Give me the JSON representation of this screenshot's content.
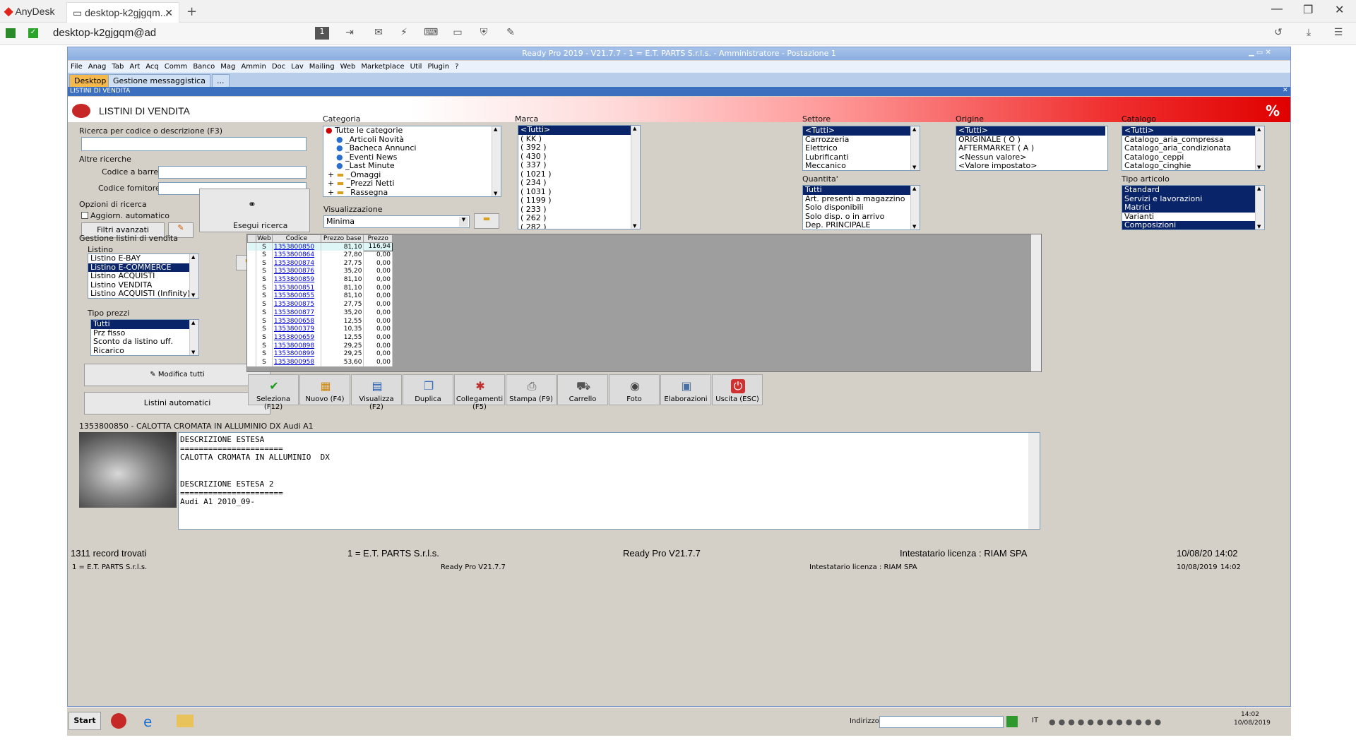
{
  "anydesk": {
    "app_name": "AnyDesk",
    "tab_title": "desktop-k2gjgqm...",
    "address": "desktop-k2gjgqm@ad"
  },
  "app": {
    "title": "Ready Pro 2019 - V21.7.7 - 1 = E.T. PARTS S.r.l.s. - Amministratore - Postazione 1",
    "menu": [
      "File",
      "Anag",
      "Tab",
      "Art",
      "Acq",
      "Comm",
      "Banco",
      "Mag",
      "Ammin",
      "Doc",
      "Lav",
      "Mailing",
      "Web",
      "Marketplace",
      "Util",
      "Plugin",
      "?"
    ],
    "tabs": [
      "Desktop",
      "Gestione messaggistica",
      "..."
    ],
    "panel_title": "LISTINI DI VENDITA",
    "header_title": "LISTINI DI VENDITA"
  },
  "search": {
    "group_label": "Ricerca per codice o descrizione (F3)",
    "altre_label": "Altre ricerche",
    "barcode_label": "Codice a barre :",
    "supplier_label": "Codice fornitore :",
    "options_label": "Opzioni di ricerca",
    "auto_update_label": "Aggiorn. automatico",
    "advanced_filters": "Filtri avanzati",
    "execute_label": "Esegui ricerca"
  },
  "categoria": {
    "label": "Categoria",
    "items": [
      "Tutte le categorie",
      "_Articoli Novità",
      "_Bacheca Annunci",
      "_Eventi News",
      "_Last Minute",
      "_Omaggi",
      "_Prezzi Netti",
      "_Rassegna"
    ]
  },
  "visualizzazione": {
    "label": "Visualizzazione",
    "value": "Minima"
  },
  "marca": {
    "label": "Marca",
    "items": [
      "<Tutti>",
      "( KK )",
      "( 392 )",
      "( 430 )",
      "( 337 )",
      "( 1021 )",
      "( 234 )",
      "( 1031 )",
      "( 1199 )",
      "( 233 )",
      "( 262 )",
      "( 282 )"
    ]
  },
  "settore": {
    "label": "Settore",
    "items": [
      "<Tutti>",
      "Carrozzeria",
      "Elettrico",
      "Lubrificanti",
      "Meccanico"
    ]
  },
  "quantita": {
    "label": "Quantita'",
    "items": [
      "Tutti",
      "Art. presenti a magazzino",
      "Solo disponibili",
      "Solo disp. o in arrivo",
      "Dep. PRINCIPALE"
    ]
  },
  "origine": {
    "label": "Origine",
    "items": [
      "<Tutti>",
      "ORIGINALE ( O )",
      "AFTERMARKET ( A )",
      "<Nessun valore>",
      "<Valore impostato>"
    ]
  },
  "catalogo": {
    "label": "Catalogo",
    "items": [
      "<Tutti>",
      "Catalogo_aria_compressa",
      "Catalogo_aria_condizionata",
      "Catalogo_ceppi",
      "Catalogo_cinghie"
    ]
  },
  "tipo_articolo": {
    "label": "Tipo articolo",
    "items": [
      "Standard",
      "Servizi e lavorazioni",
      "Matrici",
      "Varianti",
      "Composizioni"
    ]
  },
  "gestione": {
    "label": "Gestione listini di vendita",
    "listino_label": "Listino",
    "listini": [
      "Listino E-BAY",
      "Listino E-COMMERCE",
      "Listino ACQUISTI",
      "Listino VENDITA",
      "Listino ACQUISTI (Infinity)"
    ],
    "tipo_prezzi_label": "Tipo prezzi",
    "tipo_prezzi": [
      "Tutti",
      "Prz fisso",
      "Sconto da listino uff.",
      "Ricarico"
    ],
    "modifica_tutti": "Modifica tutti",
    "listini_automatici": "Listini automatici"
  },
  "grid": {
    "headers": [
      "Web",
      "Codice",
      "Prezzo base",
      "Prezzo"
    ],
    "rows": [
      [
        "S",
        "1353800850",
        "81,10",
        "116,94"
      ],
      [
        "S",
        "1353800864",
        "27,80",
        "0,00"
      ],
      [
        "S",
        "1353800874",
        "27,75",
        "0,00"
      ],
      [
        "S",
        "1353800876",
        "35,20",
        "0,00"
      ],
      [
        "S",
        "1353800859",
        "81,10",
        "0,00"
      ],
      [
        "S",
        "1353800851",
        "81,10",
        "0,00"
      ],
      [
        "S",
        "1353800855",
        "81,10",
        "0,00"
      ],
      [
        "S",
        "1353800875",
        "27,75",
        "0,00"
      ],
      [
        "S",
        "1353800877",
        "35,20",
        "0,00"
      ],
      [
        "S",
        "1353800658",
        "12,55",
        "0,00"
      ],
      [
        "S",
        "1353800379",
        "10,35",
        "0,00"
      ],
      [
        "S",
        "1353800659",
        "12,55",
        "0,00"
      ],
      [
        "S",
        "1353800898",
        "29,25",
        "0,00"
      ],
      [
        "S",
        "1353800899",
        "29,25",
        "0,00"
      ],
      [
        "S",
        "1353800958",
        "53,60",
        "0,00"
      ]
    ]
  },
  "toolbar": [
    "Seleziona (F12)",
    "Nuovo (F4)",
    "Visualizza (F2)",
    "Duplica",
    "Collegamenti (F5)",
    "Stampa (F9)",
    "Carrello",
    "Foto",
    "Elaborazioni",
    "Uscita (ESC)"
  ],
  "detail": {
    "caption": "1353800850 - CALOTTA CROMATA IN ALLUMINIO DX Audi A1",
    "text": "DESCRIZIONE ESTESA\n======================\nCALOTTA CROMATA IN ALLUMINIO  DX\n\n\nDESCRIZIONE ESTESA 2\n======================\nAudi A1 2010_09-"
  },
  "status": {
    "records": "1311 record trovati",
    "company": "1 = E.T. PARTS S.r.l.s.",
    "version": "Ready Pro V21.7.7",
    "license": "Intestatario licenza : RIAM SPA",
    "date": "10/08/20",
    "time": "14:02",
    "company2": "1 = E.T. PARTS S.r.l.s.",
    "version2": "Ready Pro V21.7.7",
    "license2": "Intestatario licenza : RIAM SPA",
    "date2": "10/08/2019",
    "time2": "14:02"
  },
  "taskbar": {
    "start": "Start",
    "indirizzo": "Indirizzo",
    "lang": "IT",
    "clock_time": "14:02",
    "clock_date": "10/08/2019"
  }
}
